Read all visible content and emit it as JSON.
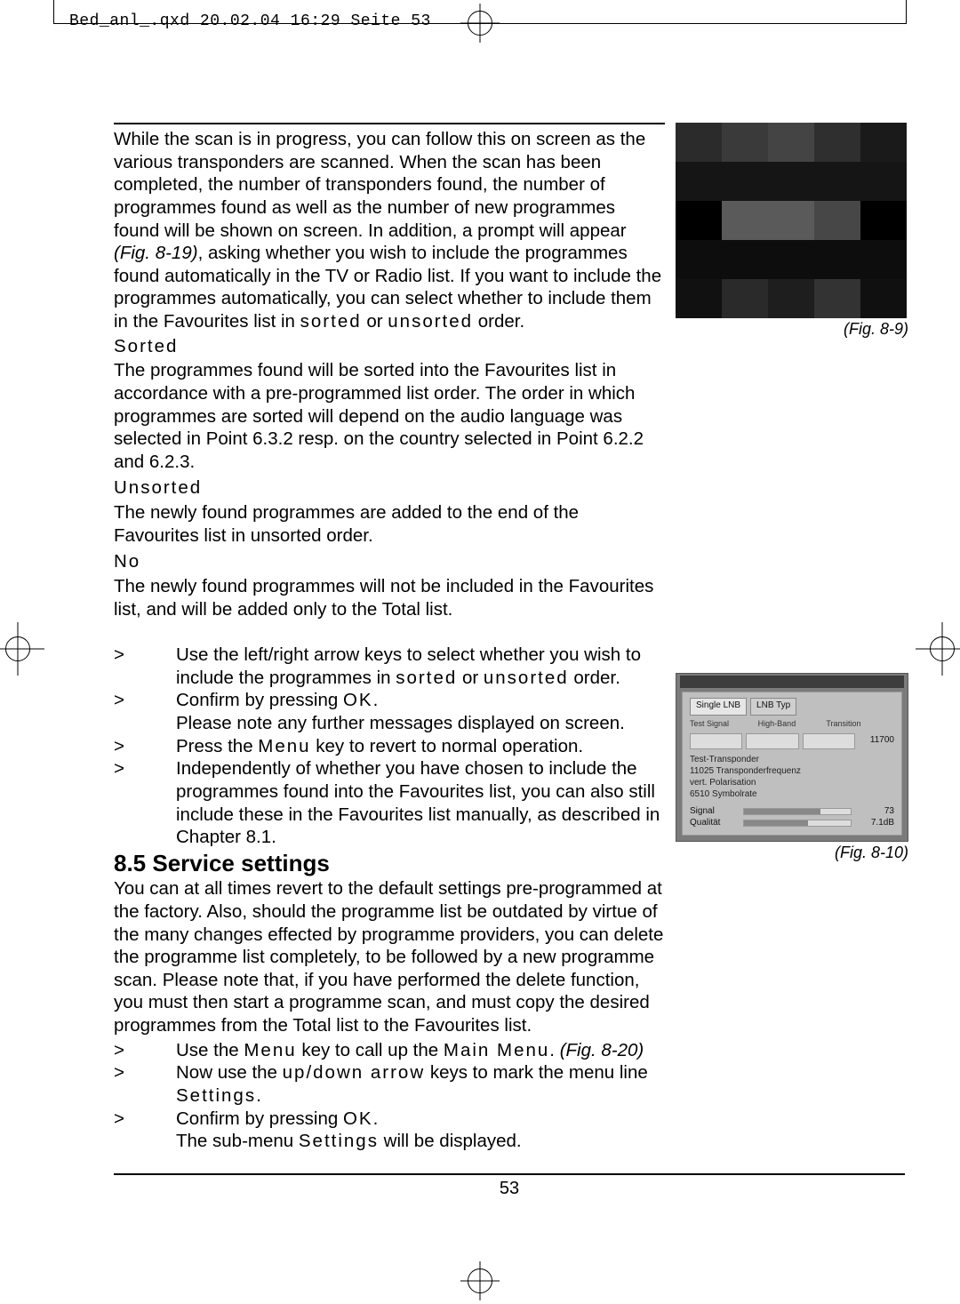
{
  "print_header": "Bed_anl_.qxd  20.02.04  16:29  Seite 53",
  "page_number": "53",
  "main": {
    "para_intro_a": "While the scan is in progress, you can follow this on screen as the various transponders are scanned. When the scan has been completed, the number of transponders found, the number of programmes found as well as the number of new programmes found will be shown  on screen. In addition, a prompt will appear ",
    "fig_ref_819": "(Fig. 8-19)",
    "para_intro_b": ", asking whether you wish to include the programmes found automatically in the TV or Radio list. If you want to include the programmes automatically, you can select whether to include them in the Favourites list in ",
    "term_sorted_inline": "sorted",
    "para_intro_c": " or ",
    "term_unsorted_inline": "unsorted",
    "para_intro_d": " order.",
    "sorted_head": "Sorted",
    "sorted_body": "The programmes found will be sorted into the Favourites list in accordance with a pre-programmed list order. The order in which programmes are sorted will depend on the audio language was selected in Point 6.3.2 resp. on the country selected in Point 6.2.2 and 6.2.3.",
    "unsorted_head": "Unsorted",
    "unsorted_body": "The newly found programmes are added to the end of the Favourites list in unsorted order.",
    "no_head": "No",
    "no_body": "The newly found programmes will not be included in the Favourites list, and will be added only to the Total list.",
    "list1": [
      {
        "a": "Use the left/right arrow keys to select whether you wish to include the programmes in ",
        "t1": "sorted",
        "b": " or ",
        "t2": "unsorted",
        "c": " order."
      },
      {
        "a": "Confirm by pressing ",
        "t1": "OK",
        "b": ".",
        "cont": "Please note any further messages displayed on screen."
      },
      {
        "a": "Press the ",
        "t1": "Menu",
        "b": " key to revert to normal operation."
      },
      {
        "a": "Independently of whether you have chosen to include the programmes found into the Favourites list, you can also still include these in the Favourites list manually, as described in Chapter 8.1."
      }
    ],
    "section_heading": "8.5 Service settings",
    "section_body": "You can at all times revert to the default settings pre-programmed at the factory. Also, should the programme list be outdated by virtue of the many changes effected by programme providers, you can delete the programme list completely, to be followed by a new programme scan. Please note that, if you have performed the delete function, you must then start a programme scan, and must copy the desired programmes from the Total list to the Favourites list.",
    "list2": [
      {
        "a": "Use the ",
        "t1": "Menu",
        "b": " key to call up the ",
        "t2": "Main Menu",
        "c": ". ",
        "italic": "(Fig. 8-20)"
      },
      {
        "a": "Now use the ",
        "t1": "up/down arrow",
        "b": " keys to mark the menu line ",
        "t2": "Settings",
        "c": "."
      },
      {
        "a": "Confirm by pressing ",
        "t1": "OK",
        "b": ".",
        "cont_a": "The sub-menu ",
        "cont_t": "Settings",
        "cont_b": " will be displayed."
      }
    ]
  },
  "figures": {
    "fig89_caption": "(Fig. 8-9)",
    "fig810_caption": "(Fig. 8-10)",
    "fig810": {
      "tab1": "Single LNB",
      "tab2": "LNB Typ",
      "head1": "Test Signal",
      "head2": "High-Band",
      "head3": "Transition",
      "val_right": "11700",
      "section_label": "Test-Transponder",
      "line1": "11025 Transponderfrequenz",
      "line2": "vert. Polarisation",
      "line3": "6510 Symbolrate",
      "bar1_label": "Signal",
      "bar1_val": "73",
      "bar2_label": "Qualität",
      "bar2_val": "7.1dB"
    }
  }
}
